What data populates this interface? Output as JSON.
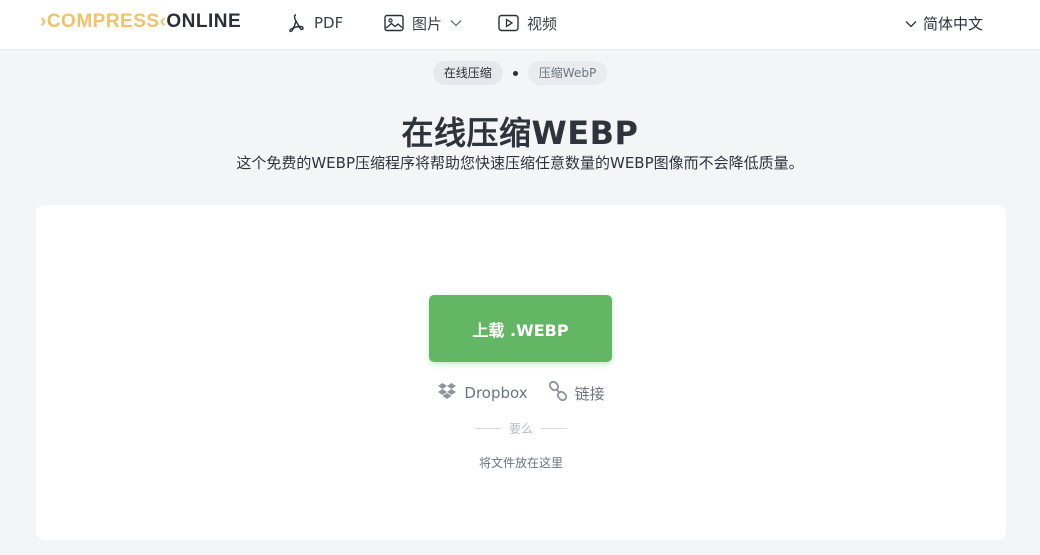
{
  "header": {
    "logo_part1": "COMPRESS",
    "logo_part2": "ONLINE",
    "nav": {
      "pdf": "PDF",
      "images": "图片",
      "video": "视频"
    },
    "language": "简体中文"
  },
  "breadcrumb": {
    "items": [
      "在线压缩",
      "压缩WebP"
    ]
  },
  "page": {
    "title": "在线压缩WEBP",
    "subtitle": "这个免费的WEBP压缩程序将帮助您快速压缩任意数量的WEBP图像而不会降低质量。"
  },
  "upload": {
    "button_label": "上载 .WEBP",
    "sources": {
      "dropbox": "Dropbox",
      "link": "链接"
    },
    "or_text": "要么",
    "drop_hint": "将文件放在这里"
  },
  "colors": {
    "accent_logo": "#f0c36a",
    "upload_button": "#63b663",
    "background": "#f4f5f7"
  }
}
